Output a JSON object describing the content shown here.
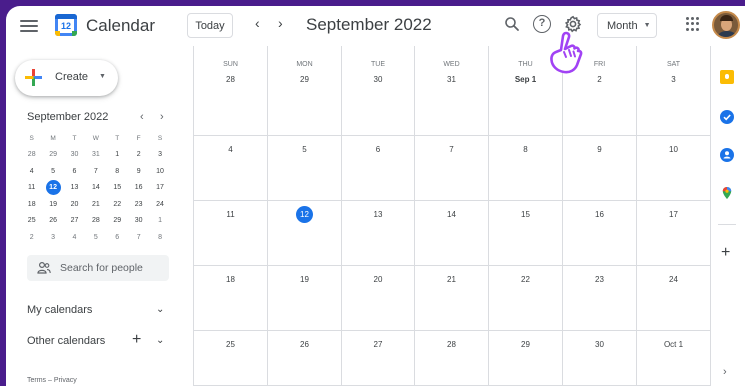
{
  "header": {
    "app_title": "Calendar",
    "logo_day": "12",
    "today_label": "Today",
    "prev_label": "‹",
    "next_label": "›",
    "period_title": "September 2022",
    "help_label": "?",
    "view_label": "Month",
    "view_caret": "▼"
  },
  "sidebar": {
    "create_label": "Create",
    "create_caret": "▼",
    "mini_calendar": {
      "title": "September 2022",
      "prev_label": "‹",
      "next_label": "›",
      "weekdays": [
        "S",
        "M",
        "T",
        "W",
        "T",
        "F",
        "S"
      ],
      "weeks": [
        [
          "28",
          "29",
          "30",
          "31",
          "1",
          "2",
          "3"
        ],
        [
          "4",
          "5",
          "6",
          "7",
          "8",
          "9",
          "10"
        ],
        [
          "11",
          "12",
          "13",
          "14",
          "15",
          "16",
          "17"
        ],
        [
          "18",
          "19",
          "20",
          "21",
          "22",
          "23",
          "24"
        ],
        [
          "25",
          "26",
          "27",
          "28",
          "29",
          "30",
          "1"
        ],
        [
          "2",
          "3",
          "4",
          "5",
          "6",
          "7",
          "8"
        ]
      ],
      "today": "12"
    },
    "people_search_placeholder": "Search for people",
    "my_calendars_label": "My calendars",
    "other_calendars_label": "Other calendars",
    "toggle_label": "⌄",
    "add_label": "+",
    "footer_text": "Terms – Privacy"
  },
  "month": {
    "weekdays": [
      "SUN",
      "MON",
      "TUE",
      "WED",
      "THU",
      "FRI",
      "SAT"
    ],
    "weeks": [
      [
        "28",
        "29",
        "30",
        "31",
        "Sep 1",
        "2",
        "3"
      ],
      [
        "4",
        "5",
        "6",
        "7",
        "8",
        "9",
        "10"
      ],
      [
        "11",
        "12",
        "13",
        "14",
        "15",
        "16",
        "17"
      ],
      [
        "18",
        "19",
        "20",
        "21",
        "22",
        "23",
        "24"
      ],
      [
        "25",
        "26",
        "27",
        "28",
        "29",
        "30",
        "Oct 1"
      ]
    ],
    "today": "12"
  },
  "rail": {
    "add_label": "+",
    "expand_label": "›"
  },
  "colors": {
    "accent": "#1a73e8",
    "frame": "#4a1d8c",
    "keep": "#fbbc04",
    "pointer": "#a142f4"
  },
  "icons": [
    "menu-icon",
    "search-icon",
    "help-icon",
    "settings-icon",
    "apps-icon",
    "pointer-hand-icon",
    "keep-icon",
    "tasks-icon",
    "contacts-icon",
    "maps-icon"
  ]
}
